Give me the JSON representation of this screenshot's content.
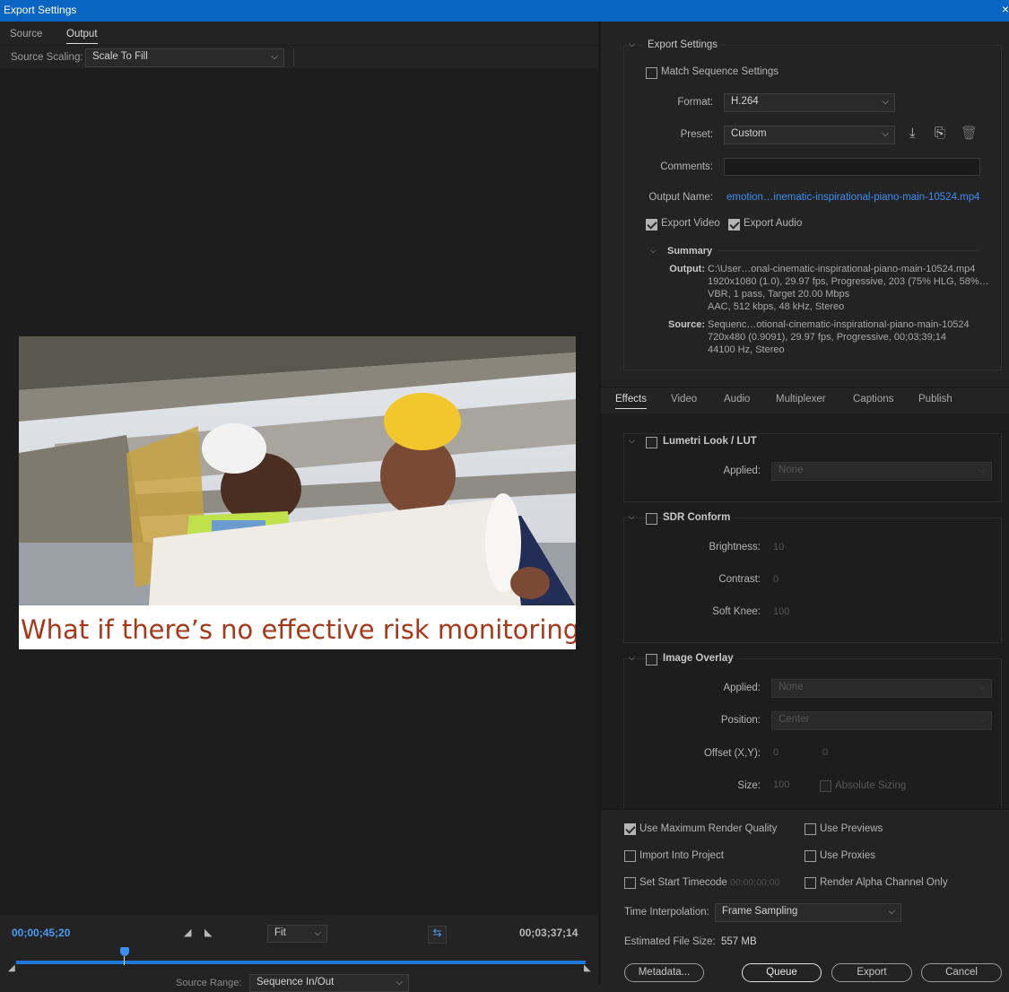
{
  "window": {
    "title": "Export Settings",
    "close": "×"
  },
  "left": {
    "tabs": [
      "Source",
      "Output"
    ],
    "source_scaling_label": "Source Scaling:",
    "source_scaling_value": "Scale To Fill",
    "preview_caption": "What if there’s no effective risk monitoring",
    "timecode_current": "00;00;45;20",
    "timecode_duration": "00;03;37;14",
    "zoom_value": "Fit",
    "source_range_label": "Source Range:",
    "source_range_value": "Sequence In/Out",
    "playhead_position": 0.19
  },
  "export_settings": {
    "header": "Export Settings",
    "match_sequence": "Match Sequence Settings",
    "format_label": "Format:",
    "format_value": "H.264",
    "preset_label": "Preset:",
    "preset_value": "Custom",
    "comments_label": "Comments:",
    "comments_value": "",
    "output_name_label": "Output Name:",
    "output_name_value": "emotion…inematic-inspirational-piano-main-10524.mp4",
    "export_video": "Export Video",
    "export_audio": "Export Audio",
    "summary": {
      "header": "Summary",
      "output_label": "Output:",
      "output_lines": [
        "C:\\User…onal-cinematic-inspirational-piano-main-10524.mp4",
        "1920x1080 (1.0), 29.97 fps, Progressive, 203 (75% HLG, 58%…",
        "VBR, 1 pass, Target 20.00 Mbps",
        "AAC, 512 kbps, 48 kHz, Stereo"
      ],
      "source_label": "Source:",
      "source_lines": [
        "Sequenc…otional-cinematic-inspirational-piano-main-10524",
        "720x480 (0.9091), 29.97 fps, Progressive, 00;03;39;14",
        "44100 Hz, Stereo"
      ]
    }
  },
  "effect_tabs": [
    "Effects",
    "Video",
    "Audio",
    "Multiplexer",
    "Captions",
    "Publish"
  ],
  "effects": {
    "lumetri": {
      "title": "Lumetri Look / LUT",
      "applied_label": "Applied:",
      "applied_value": "None"
    },
    "sdr": {
      "title": "SDR Conform",
      "brightness_label": "Brightness:",
      "brightness_value": "10",
      "contrast_label": "Contrast:",
      "contrast_value": "0",
      "softknee_label": "Soft Knee:",
      "softknee_value": "100"
    },
    "overlay": {
      "title": "Image Overlay",
      "applied_label": "Applied:",
      "applied_value": "None",
      "position_label": "Position:",
      "position_value": "Center",
      "offset_label": "Offset (X,Y):",
      "offset_x": "0",
      "offset_y": "0",
      "size_label": "Size:",
      "size_value": "100",
      "absolute_sizing": "Absolute Sizing"
    }
  },
  "bottom": {
    "max_render": "Use Maximum Render Quality",
    "use_previews": "Use Previews",
    "import_project": "Import Into Project",
    "use_proxies": "Use Proxies",
    "start_timecode": "Set Start Timecode",
    "start_timecode_value": "00;00;00;00",
    "alpha_only": "Render Alpha Channel Only",
    "time_interp_label": "Time Interpolation:",
    "time_interp_value": "Frame Sampling",
    "file_size_label": "Estimated File Size:",
    "file_size_value": "557 MB",
    "buttons": {
      "metadata": "Metadata...",
      "queue": "Queue",
      "export": "Export",
      "cancel": "Cancel"
    }
  },
  "colors": {
    "accent": "#0a64c2",
    "link": "#3e8ef0",
    "timecode": "#4a9cf0",
    "caption": "#a8381a"
  }
}
